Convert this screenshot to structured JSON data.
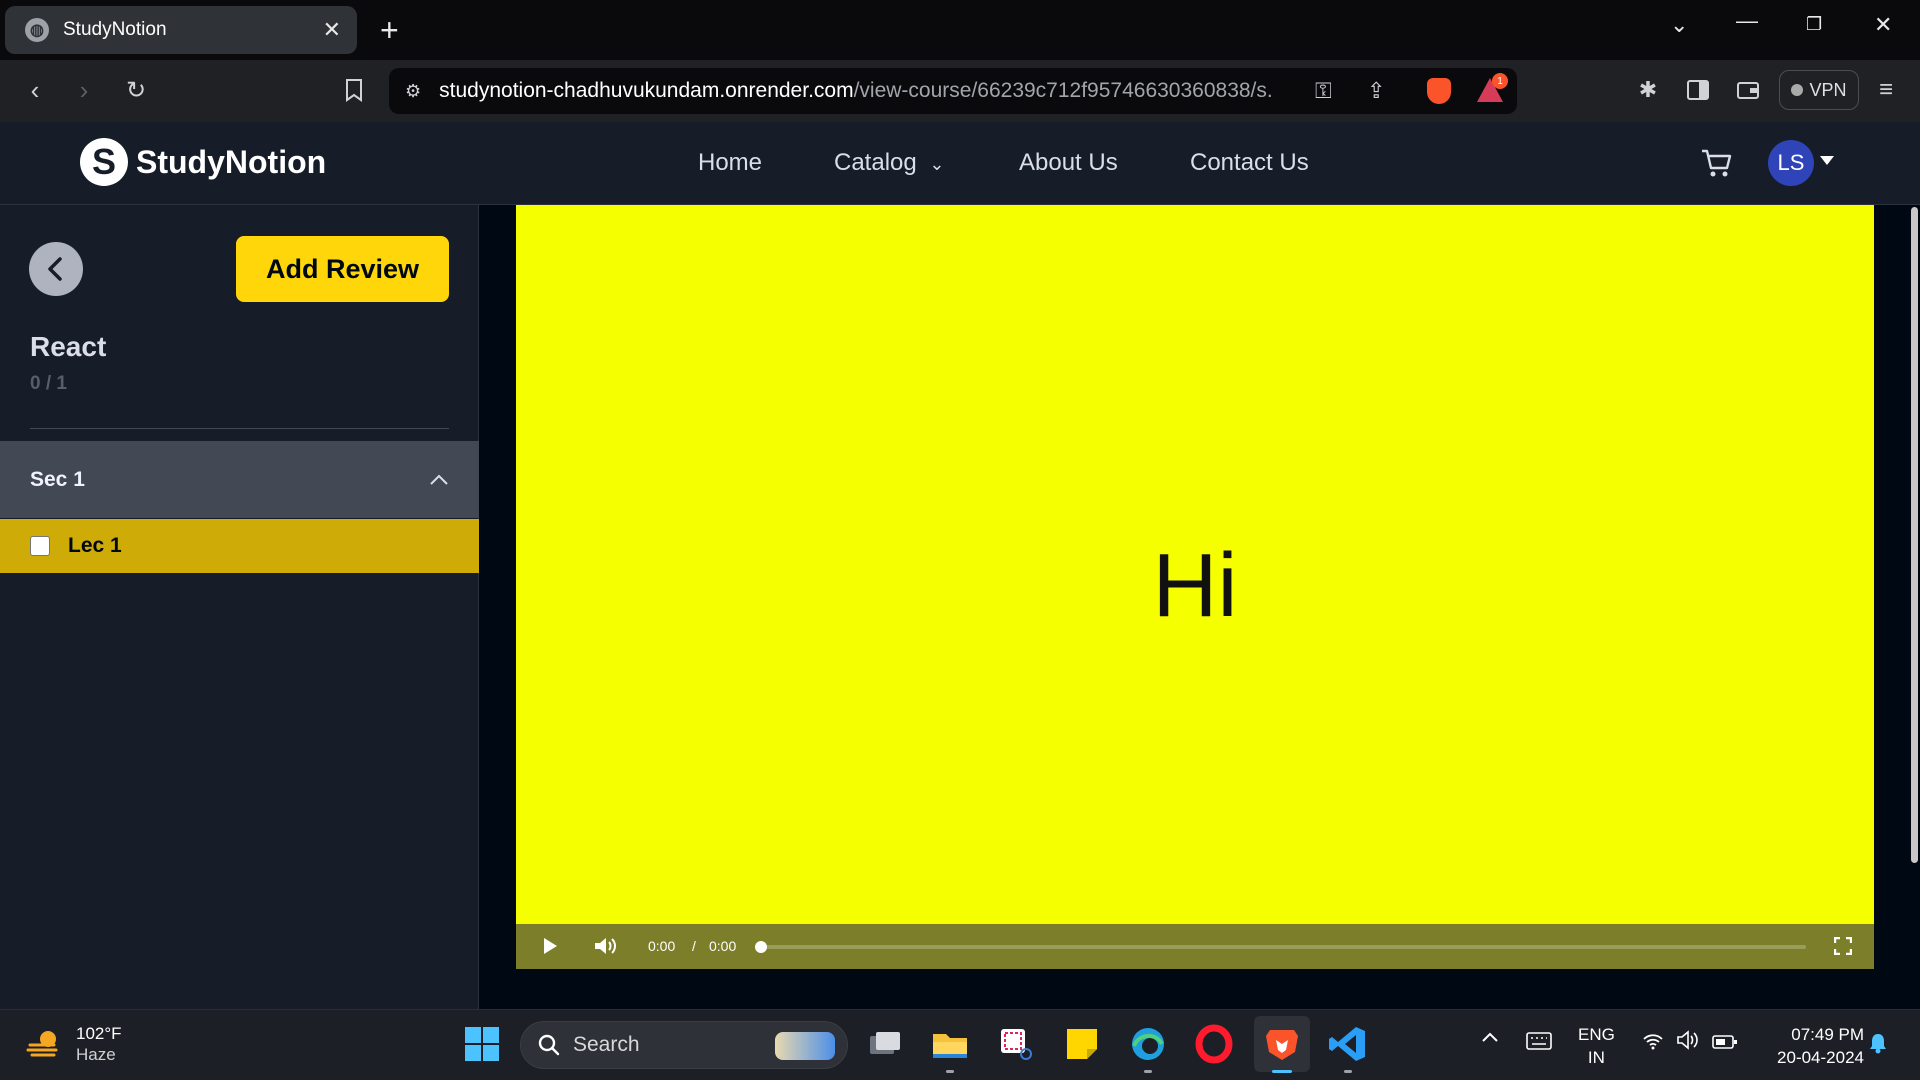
{
  "browser": {
    "tab_title": "StudyNotion",
    "url_host": "studynotion-chadhuvukundam.onrender.com",
    "url_path": "/view-course/66239c712f95746630360838/s...",
    "notification_count": "1",
    "vpn_label": "VPN"
  },
  "navbar": {
    "logo_text": "StudyNotion",
    "links": [
      "Home",
      "Catalog",
      "About Us",
      "Contact Us"
    ],
    "avatar_initials": "LS"
  },
  "sidebar": {
    "add_review_label": "Add Review",
    "course_title": "React",
    "progress": "0 / 1",
    "sections": [
      {
        "title": "Sec 1",
        "lectures": [
          {
            "title": "Lec 1",
            "completed": false
          }
        ]
      }
    ]
  },
  "video": {
    "display_text": "Hi",
    "current_time": "0:00",
    "separator": "/",
    "duration": "0:00",
    "progress_fraction": 0
  },
  "taskbar": {
    "weather_temp": "102°F",
    "weather_desc": "Haze",
    "search_label": "Search",
    "language": "ENG",
    "region": "IN",
    "time": "07:49 PM",
    "date": "20-04-2024"
  },
  "colors": {
    "accent_yellow": "#ffd60a",
    "active_lecture": "#cfab08",
    "video_background": "#f5ff00",
    "navbar": "#161d29",
    "avatar": "#2f44b8"
  }
}
